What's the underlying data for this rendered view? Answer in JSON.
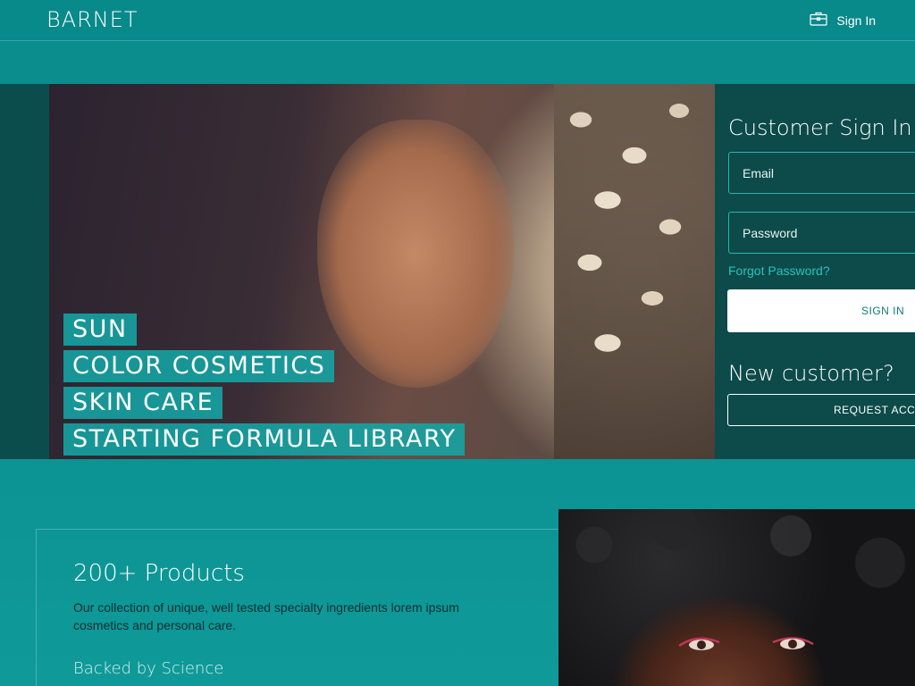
{
  "header": {
    "logo": "BARNET",
    "signin_label": "Sign In",
    "signin_icon": "briefcase-icon"
  },
  "hero": {
    "tags": [
      "SUN",
      "COLOR COSMETICS",
      "SKIN CARE",
      "STARTING FORMULA LIBRARY"
    ]
  },
  "signin_panel": {
    "title": "Customer Sign In",
    "email_placeholder": "Email",
    "password_placeholder": "Password",
    "forgot_label": "Forgot Password?",
    "signin_button": "SIGN IN",
    "new_customer_title": "New customer?",
    "request_button": "REQUEST ACCESS"
  },
  "products": {
    "title": "200+ Products",
    "description": "Our collection of unique, well tested specialty ingredients lorem ipsum cosmetics and personal care.",
    "subtitle": "Backed by Science"
  },
  "colors": {
    "brand_teal": "#0b8f8f",
    "panel_dark": "#0d4a4a",
    "accent_link": "#25c4bd"
  }
}
